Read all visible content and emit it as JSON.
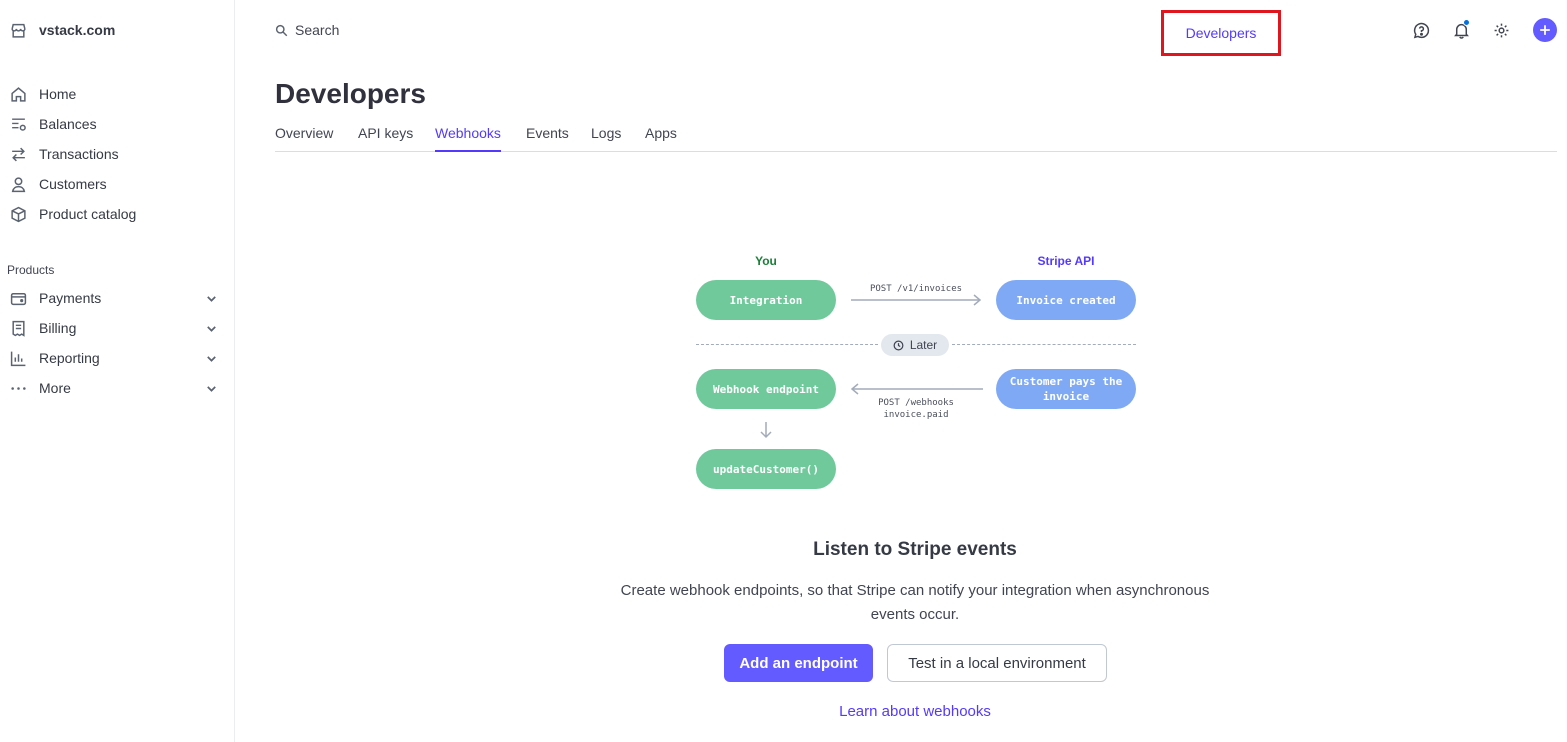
{
  "account": {
    "name": "vstack.com",
    "icon": "store-icon"
  },
  "sidebar": {
    "items": [
      {
        "label": "Home",
        "icon": "home-icon"
      },
      {
        "label": "Balances",
        "icon": "balances-icon"
      },
      {
        "label": "Transactions",
        "icon": "transactions-icon"
      },
      {
        "label": "Customers",
        "icon": "person-icon"
      },
      {
        "label": "Product catalog",
        "icon": "box-icon"
      }
    ],
    "section_label": "Products",
    "product_items": [
      {
        "label": "Payments",
        "icon": "wallet-icon"
      },
      {
        "label": "Billing",
        "icon": "invoice-icon"
      },
      {
        "label": "Reporting",
        "icon": "bar-chart-icon"
      },
      {
        "label": "More",
        "icon": "more-dots-icon"
      }
    ]
  },
  "topbar": {
    "search_placeholder": "Search",
    "developers_link": "Developers",
    "icons": [
      "help-icon",
      "bell-icon",
      "gear-icon",
      "plus-icon"
    ],
    "accent": "#635bff",
    "highlight_color": "#e0161e"
  },
  "header": {
    "title": "Developers",
    "tabs": [
      {
        "label": "Overview"
      },
      {
        "label": "API keys"
      },
      {
        "label": "Webhooks",
        "active": true
      },
      {
        "label": "Events"
      },
      {
        "label": "Logs"
      },
      {
        "label": "Apps"
      }
    ]
  },
  "diagram": {
    "you_label": "You",
    "stripe_label": "Stripe API",
    "integration": "Integration",
    "post_invoices": "POST /v1/invoices",
    "invoice_created": "Invoice created",
    "later": "Later",
    "webhook_endpoint": "Webhook endpoint",
    "customer_pays": "Customer pays the invoice",
    "post_webhooks": "POST /webhooks",
    "invoice_paid": "invoice.paid",
    "update_customer": "updateCustomer()",
    "green": "#6fc99b",
    "blue": "#7fa9f5"
  },
  "empty_state": {
    "title": "Listen to Stripe events",
    "description": "Create webhook endpoints, so that Stripe can notify your integration when asynchronous events occur.",
    "primary_button": "Add an endpoint",
    "secondary_button": "Test in a local environment",
    "learn_link": "Learn about webhooks"
  }
}
